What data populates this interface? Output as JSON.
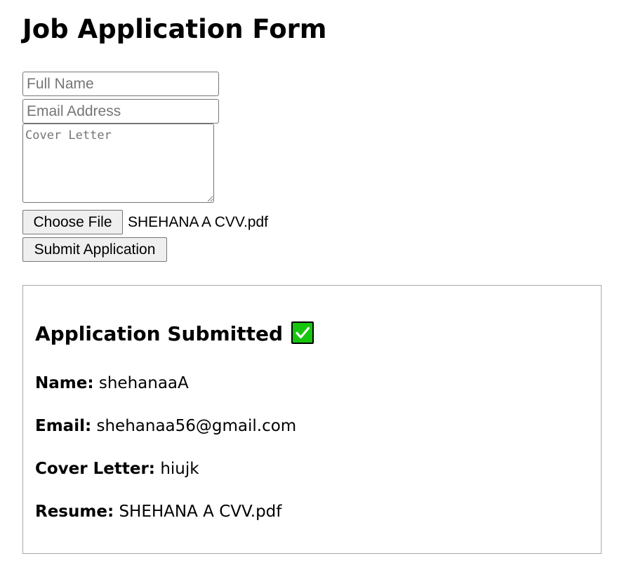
{
  "form": {
    "title": "Job Application Form",
    "name_placeholder": "Full Name",
    "email_placeholder": "Email Address",
    "cover_placeholder": "Cover Letter",
    "choose_file_label": "Choose File",
    "selected_file": "SHEHANA A CVV.pdf",
    "submit_label": "Submit Application"
  },
  "result": {
    "heading": "Application Submitted",
    "heading_icon": "white-check-mark-icon",
    "accent_color": "#16c60c",
    "name_label": "Name:",
    "name_value": "shehanaaA",
    "email_label": "Email:",
    "email_value": "shehanaa56@gmail.com",
    "cover_label": "Cover Letter:",
    "cover_value": "hiujk",
    "resume_label": "Resume:",
    "resume_value": "SHEHANA A CVV.pdf"
  }
}
